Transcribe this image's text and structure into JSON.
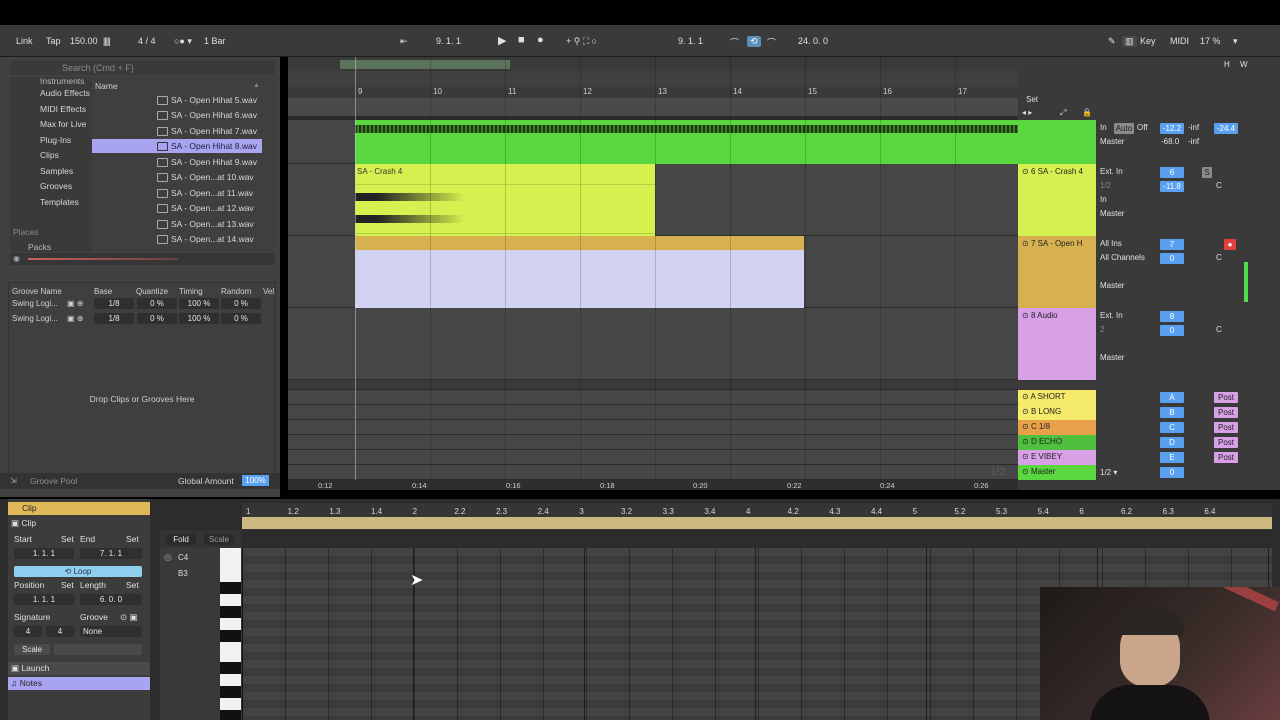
{
  "transport": {
    "link": "Link",
    "tap": "Tap",
    "tempo": "150.00",
    "signature": "4 / 4",
    "quantize": "1 Bar",
    "position1": "9.  1.  1",
    "position2": "9.  1.  1",
    "loop_length": "24.  0.  0",
    "key": "Key",
    "midi": "MIDI",
    "cpu": "17 %"
  },
  "browser": {
    "search_placeholder": "Search (Cmd + F)",
    "name_header": "Name",
    "categories": [
      "Instruments",
      "Audio Effects",
      "MIDI Effects",
      "Max for Live",
      "Plug-Ins",
      "Clips",
      "Samples",
      "Grooves",
      "Templates"
    ],
    "places_label": "Places",
    "packs_label": "Packs",
    "files": [
      "SA - Open Hihat 5.wav",
      "SA - Open Hihat 6.wav",
      "SA - Open Hihat 7.wav",
      "SA - Open Hihat 8.wav",
      "SA - Open Hihat 9.wav",
      "SA - Open...at 10.wav",
      "SA - Open...at 11.wav",
      "SA - Open...at 12.wav",
      "SA - Open...at 13.wav",
      "SA - Open...at 14.wav"
    ],
    "selected_index": 3
  },
  "groove_pool": {
    "headers": [
      "Groove Name",
      "Base",
      "Quantize",
      "Timing",
      "Random",
      "Vel"
    ],
    "rows": [
      {
        "name": "Swing Logi...",
        "base": "1/8",
        "quantize": "0 %",
        "timing": "100 %",
        "random": "0 %"
      },
      {
        "name": "Swing Logi...",
        "base": "1/8",
        "quantize": "0 %",
        "timing": "100 %",
        "random": "0 %"
      }
    ],
    "drop_hint": "Drop Clips or Grooves Here",
    "footer": "Groove Pool",
    "global_amount_label": "Global Amount",
    "global_amount_value": "100%"
  },
  "arrangement": {
    "bars": [
      "9",
      "10",
      "11",
      "12",
      "13",
      "14",
      "15",
      "16",
      "17"
    ],
    "set_label": "Set",
    "clip_crash_name": "SA - Crash 4",
    "time_labels": [
      "0:12",
      "0:14",
      "0:16",
      "0:18",
      "0:20",
      "0:22",
      "0:24",
      "0:26"
    ],
    "page_indicator": "1/2"
  },
  "tracks": [
    {
      "name": "",
      "color": "#5ad63e",
      "input": "",
      "routing": "Master",
      "num": "",
      "vol": "-12.2",
      "pan": "-inf",
      "peak": "-24.4",
      "extra": "-68.0"
    },
    {
      "name": "6 SA - Crash 4",
      "color": "#d6f050",
      "input": "Ext. In",
      "channel": "1/2",
      "routing": "Master",
      "num": "6",
      "vol": "-11.8",
      "pan": "C"
    },
    {
      "name": "7 SA - Open H",
      "color": "#d7b050",
      "input": "All Ins",
      "channel": "All Channels",
      "routing": "Master",
      "num": "7",
      "vol": "0",
      "pan": "C"
    },
    {
      "name": "8 Audio",
      "color": "#d8a0e6",
      "input": "Ext. In",
      "channel": "2",
      "routing": "Master",
      "num": "8",
      "vol": "0",
      "pan": "C"
    }
  ],
  "returns": [
    {
      "name": "A SHORT",
      "color": "#f5ea6a",
      "letter": "A"
    },
    {
      "name": "B LONG",
      "color": "#f5ea6a",
      "letter": "B"
    },
    {
      "name": "C 1/8",
      "color": "#e8a04a",
      "letter": "C"
    },
    {
      "name": "D ECHO",
      "color": "#4fbf3e",
      "letter": "D"
    },
    {
      "name": "E VIBEY",
      "color": "#d8a0e6",
      "letter": "E"
    }
  ],
  "master": {
    "name": "Master",
    "routing": "1/2",
    "vol": "0"
  },
  "mixer_labels": {
    "in": "In",
    "auto": "Auto",
    "off": "Off",
    "s": "S",
    "post": "Post",
    "inf": "-inf"
  },
  "clip_panel": {
    "header": "Clip",
    "clip_label": "Clip",
    "start_label": "Start",
    "set_label": "Set",
    "end_label": "End",
    "start_value": "1.  1.  1",
    "end_value": "7.  1.  1",
    "loop_label": "Loop",
    "position_label": "Position",
    "length_label": "Length",
    "position_value": "1.  1.  1",
    "length_value": "6.  0.  0",
    "signature_label": "Signature",
    "groove_label": "Groove",
    "sig_num": "4",
    "sig_den": "4",
    "groove_value": "None",
    "scale_label": "Scale",
    "launch_label": "Launch",
    "notes_label": "Notes"
  },
  "midi_editor": {
    "fold": "Fold",
    "scale": "Scale",
    "note_c4": "C4",
    "note_b3": "B3",
    "ruler": [
      "1",
      "1.2",
      "1.3",
      "1.4",
      "2",
      "2.2",
      "2.3",
      "2.4",
      "3",
      "3.2",
      "3.3",
      "3.4",
      "4",
      "4.2",
      "4.3",
      "4.4",
      "5",
      "5.2",
      "5.3",
      "5.4",
      "6",
      "6.2",
      "6.3",
      "6.4"
    ]
  },
  "colors": {
    "green": "#5ad63e",
    "lime": "#d6f050",
    "gold": "#d7b050",
    "lavender": "#d2d2f2",
    "pink": "#d8a0e6",
    "accent_blue": "#5aa0f0"
  }
}
